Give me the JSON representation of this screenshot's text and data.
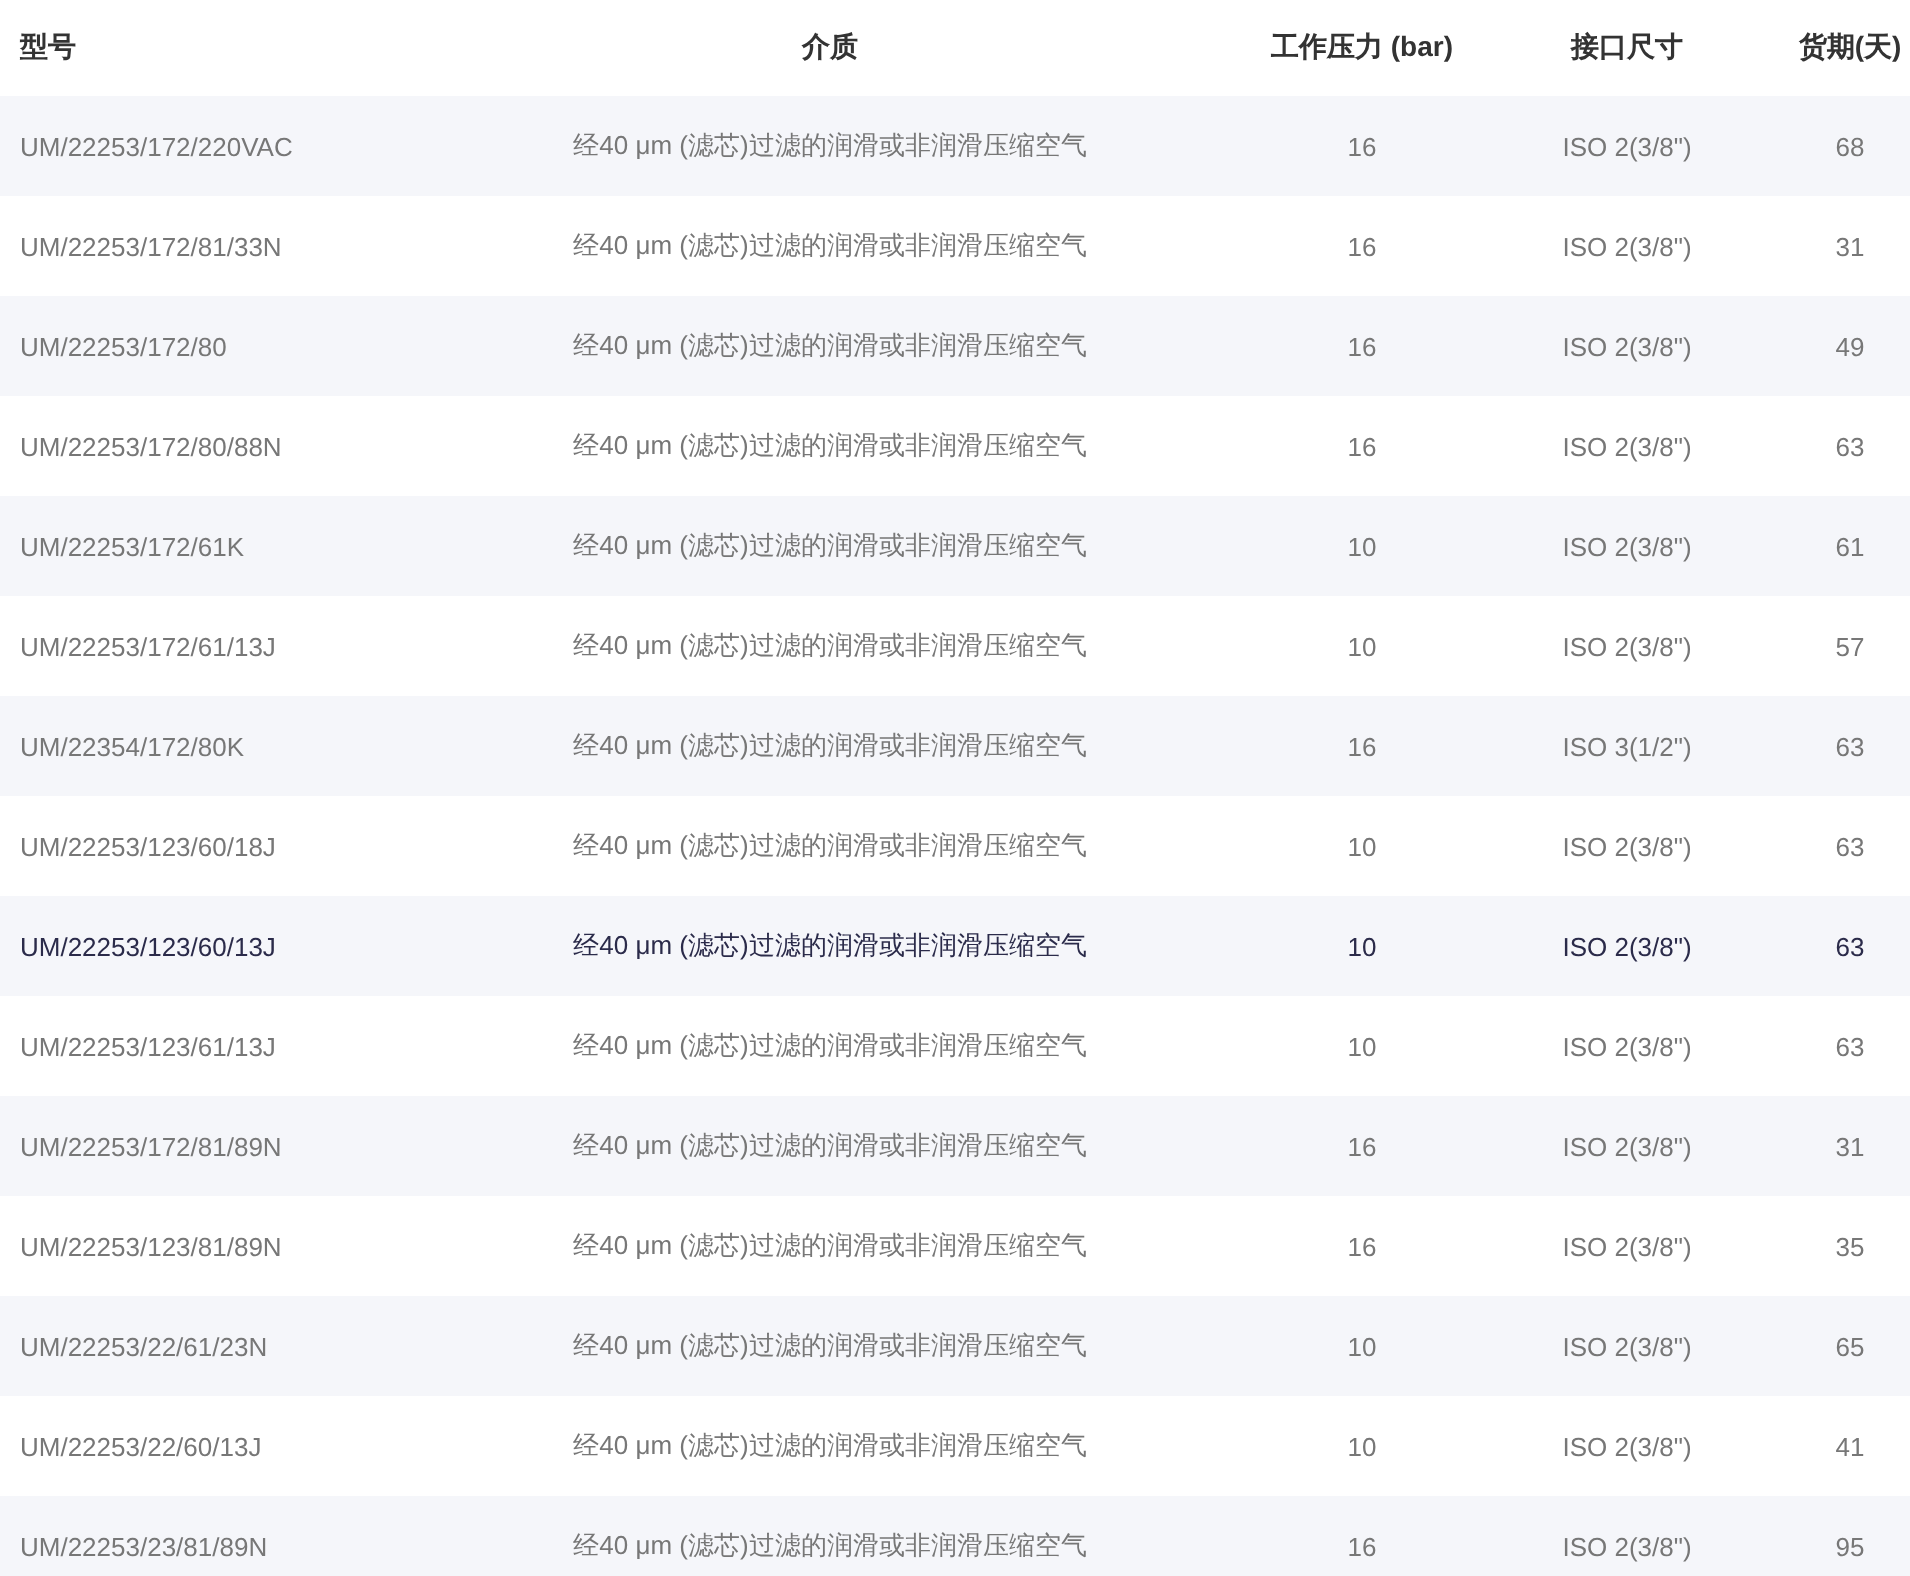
{
  "table": {
    "columns": [
      "型号",
      "介质",
      "工作压力 (bar)",
      "接口尺寸",
      "货期(天)"
    ],
    "rows": [
      {
        "cells": [
          "UM/22253/172/220VAC",
          "经40 μm (滤芯)过滤的润滑或非润滑压缩空气",
          "16",
          "ISO 2(3/8\")",
          "68"
        ],
        "selected": false
      },
      {
        "cells": [
          "UM/22253/172/81/33N",
          "经40 μm (滤芯)过滤的润滑或非润滑压缩空气",
          "16",
          "ISO 2(3/8\")",
          "31"
        ],
        "selected": false
      },
      {
        "cells": [
          "UM/22253/172/80",
          "经40 μm (滤芯)过滤的润滑或非润滑压缩空气",
          "16",
          "ISO 2(3/8\")",
          "49"
        ],
        "selected": false
      },
      {
        "cells": [
          "UM/22253/172/80/88N",
          "经40 μm (滤芯)过滤的润滑或非润滑压缩空气",
          "16",
          "ISO 2(3/8\")",
          "63"
        ],
        "selected": false
      },
      {
        "cells": [
          "UM/22253/172/61K",
          "经40 μm (滤芯)过滤的润滑或非润滑压缩空气",
          "10",
          "ISO 2(3/8\")",
          "61"
        ],
        "selected": false
      },
      {
        "cells": [
          "UM/22253/172/61/13J",
          "经40 μm (滤芯)过滤的润滑或非润滑压缩空气",
          "10",
          "ISO 2(3/8\")",
          "57"
        ],
        "selected": false
      },
      {
        "cells": [
          "UM/22354/172/80K",
          "经40 μm (滤芯)过滤的润滑或非润滑压缩空气",
          "16",
          "ISO 3(1/2\")",
          "63"
        ],
        "selected": false
      },
      {
        "cells": [
          "UM/22253/123/60/18J",
          "经40 μm (滤芯)过滤的润滑或非润滑压缩空气",
          "10",
          "ISO 2(3/8\")",
          "63"
        ],
        "selected": false
      },
      {
        "cells": [
          "UM/22253/123/60/13J",
          "经40 μm (滤芯)过滤的润滑或非润滑压缩空气",
          "10",
          "ISO 2(3/8\")",
          "63"
        ],
        "selected": true
      },
      {
        "cells": [
          "UM/22253/123/61/13J",
          "经40 μm (滤芯)过滤的润滑或非润滑压缩空气",
          "10",
          "ISO 2(3/8\")",
          "63"
        ],
        "selected": false
      },
      {
        "cells": [
          "UM/22253/172/81/89N",
          "经40 μm (滤芯)过滤的润滑或非润滑压缩空气",
          "16",
          "ISO 2(3/8\")",
          "31"
        ],
        "selected": false
      },
      {
        "cells": [
          "UM/22253/123/81/89N",
          "经40 μm (滤芯)过滤的润滑或非润滑压缩空气",
          "16",
          "ISO 2(3/8\")",
          "35"
        ],
        "selected": false
      },
      {
        "cells": [
          "UM/22253/22/61/23N",
          "经40 μm (滤芯)过滤的润滑或非润滑压缩空气",
          "10",
          "ISO 2(3/8\")",
          "65"
        ],
        "selected": false
      },
      {
        "cells": [
          "UM/22253/22/60/13J",
          "经40 μm (滤芯)过滤的润滑或非润滑压缩空气",
          "10",
          "ISO 2(3/8\")",
          "41"
        ],
        "selected": false
      },
      {
        "cells": [
          "UM/22253/23/81/89N",
          "经40 μm (滤芯)过滤的润滑或非润滑压缩空气",
          "16",
          "ISO 2(3/8\")",
          "95"
        ],
        "selected": false
      }
    ]
  }
}
